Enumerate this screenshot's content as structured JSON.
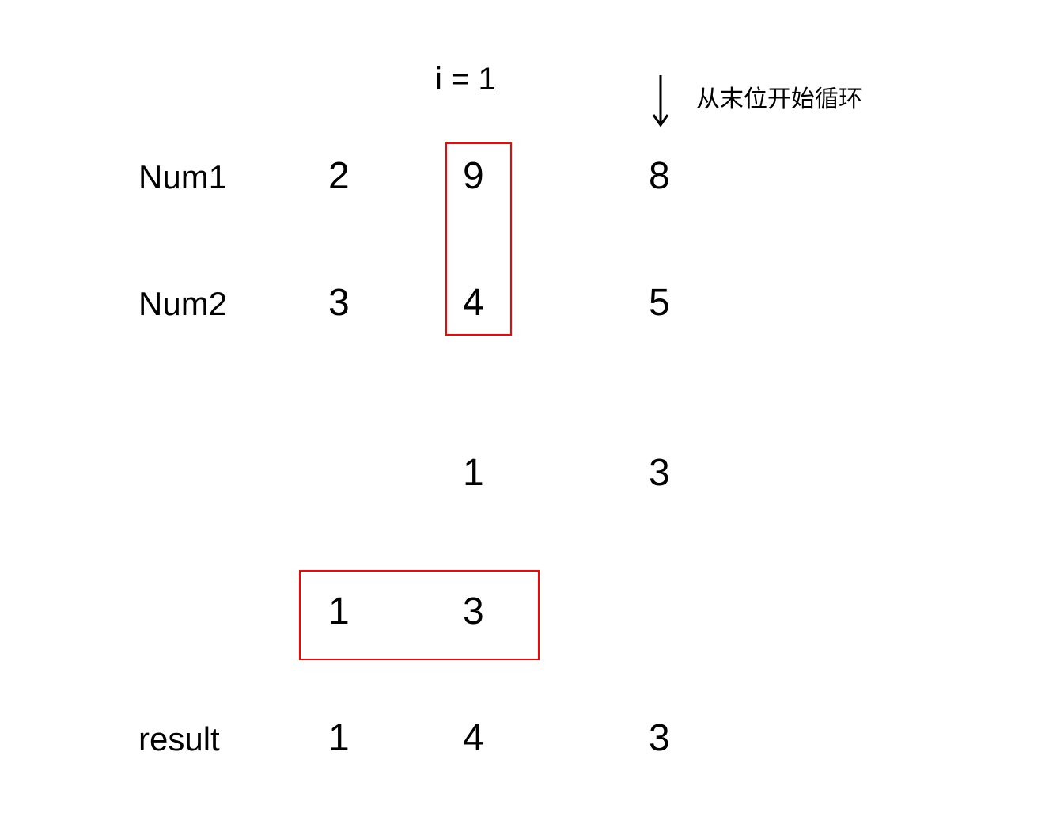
{
  "header": {
    "index_label": "i = 1"
  },
  "annotation": {
    "arrow_label": "从末位开始循环"
  },
  "rows": {
    "num1": {
      "label": "Num1",
      "digits": [
        "2",
        "9",
        "8"
      ]
    },
    "num2": {
      "label": "Num2",
      "digits": [
        "3",
        "4",
        "5"
      ]
    },
    "partial1": {
      "digits": [
        "",
        "1",
        "3"
      ]
    },
    "partial2": {
      "digits": [
        "1",
        "3",
        ""
      ]
    },
    "result": {
      "label": "result",
      "digits": [
        "1",
        "4",
        "3"
      ]
    }
  }
}
